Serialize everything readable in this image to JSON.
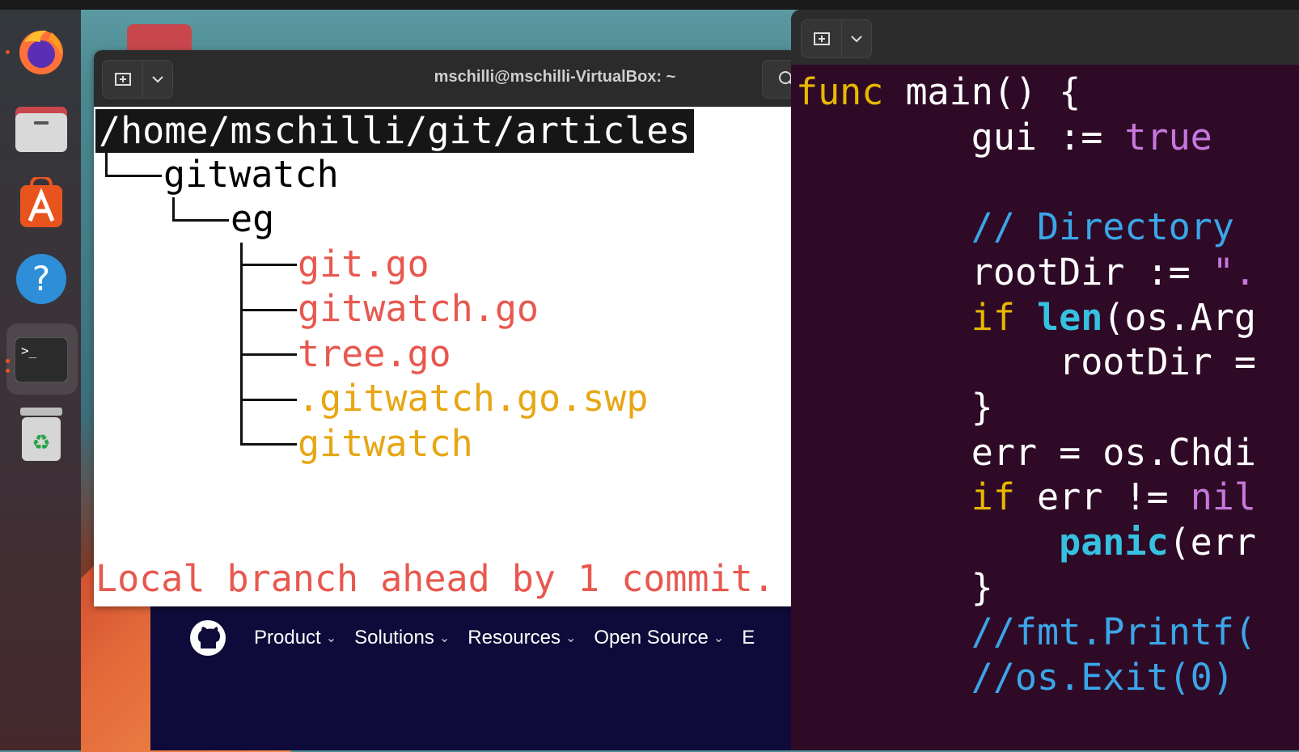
{
  "terminal": {
    "title": "mschilli@mschilli-VirtualBox: ~",
    "path": "/home/mschilli/git/articles",
    "tree": [
      {
        "text": "gitwatch",
        "color": "#111111"
      },
      {
        "text": "eg",
        "color": "#111111"
      },
      {
        "text": "git.go",
        "color": "#e8584f"
      },
      {
        "text": "gitwatch.go",
        "color": "#e8584f"
      },
      {
        "text": "tree.go",
        "color": "#e8584f"
      },
      {
        "text": ".gitwatch.go.swp",
        "color": "#e7a613"
      },
      {
        "text": "gitwatch",
        "color": "#e7a613"
      }
    ],
    "status": "Local branch ahead by 1 commit."
  },
  "editor": {
    "lines": [
      "func main() {",
      "gui := true",
      "",
      "// Directory",
      "rootDir := \".",
      "if len(os.Arg",
      "rootDir =",
      "}",
      "err = os.Chdi",
      "if err != nil",
      "panic(err",
      "}",
      "//fmt.Printf(",
      "//os.Exit(0)"
    ]
  },
  "github_nav": {
    "items": [
      "Product",
      "Solutions",
      "Resources",
      "Open Source",
      "E"
    ]
  },
  "dock": {
    "apps": [
      "firefox-icon",
      "files-icon",
      "app-center-icon",
      "help-icon",
      "terminal-icon",
      "trash-icon"
    ]
  }
}
